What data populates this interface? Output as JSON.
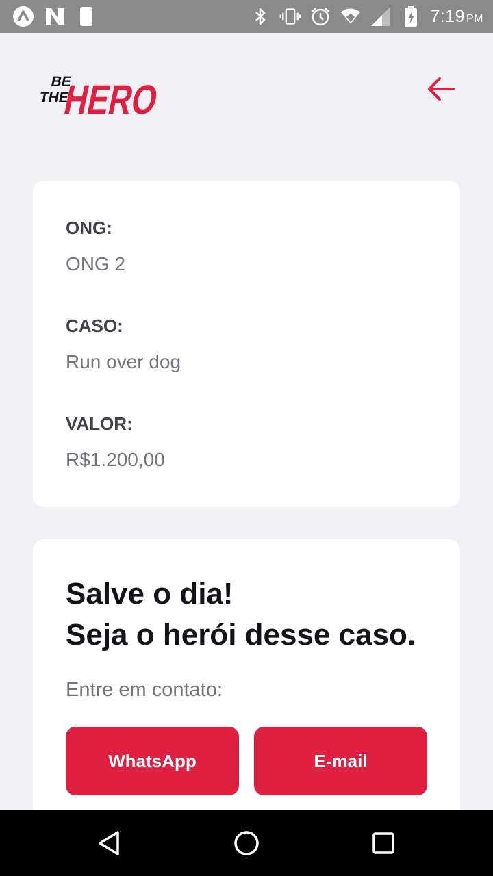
{
  "status_bar": {
    "time": "7:19",
    "ampm": "PM",
    "icons": [
      "app-a-icon",
      "app-n-icon",
      "app-moon-icon",
      "bluetooth-icon",
      "vibrate-icon",
      "alarm-icon",
      "wifi-icon",
      "signal-icon",
      "battery-charging-icon"
    ]
  },
  "header": {
    "logo_text_small_1": "BE",
    "logo_text_small_2": "THE",
    "logo_text_big": "HERO",
    "back_icon": "arrow-left-icon"
  },
  "incident": {
    "ong_label": "ONG:",
    "ong_value": "ONG 2",
    "case_label": "CASO:",
    "case_value": "Run over dog",
    "value_label": "VALOR:",
    "value_value": "R$1.200,00"
  },
  "contact": {
    "title_line1": "Salve o dia!",
    "title_line2": "Seja o herói desse caso.",
    "description": "Entre em contato:",
    "whatsapp_label": "WhatsApp",
    "email_label": "E-mail"
  },
  "nav_bar": {
    "icons": [
      "back-triangle-icon",
      "home-circle-icon",
      "recents-square-icon"
    ]
  },
  "colors": {
    "accent": "#e02041",
    "background": "#f0f0f5",
    "label": "#41414d",
    "value": "#737380"
  }
}
